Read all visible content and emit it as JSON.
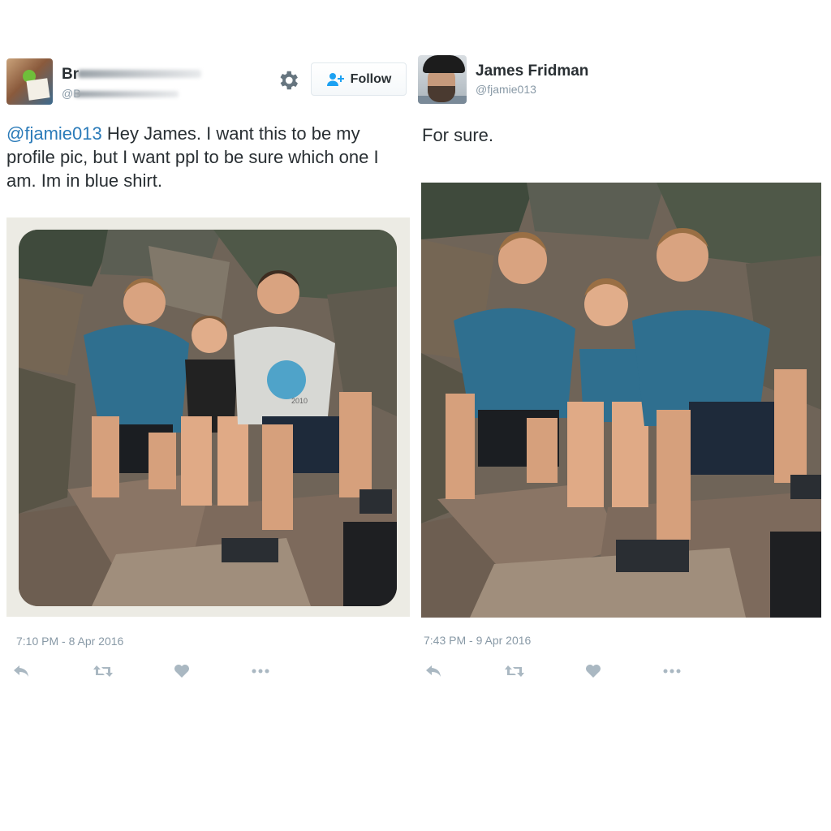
{
  "original_tweet": {
    "author_name_visible": "Br",
    "author_handle_visible": "@B",
    "follow_label": "Follow",
    "mention": "@fjamie013",
    "body": " Hey James. I want this to be my profile pic, but I want ppl to be sure which one I am. Im in blue shirt.",
    "timestamp": "7:10 PM - 8 Apr 2016",
    "photo_shirt_text": "2010",
    "actions": [
      "reply-icon",
      "retweet-icon",
      "like-icon",
      "more-icon"
    ]
  },
  "reply_tweet": {
    "author_name": "James Fridman",
    "author_handle": "@fjamie013",
    "body": "For sure.",
    "timestamp": "7:43 PM - 9 Apr 2016",
    "actions": [
      "reply-icon",
      "retweet-icon",
      "like-icon",
      "more-icon"
    ]
  },
  "colors": {
    "link": "#2b7bb9",
    "muted": "#8899a6",
    "icon": "#aab8c2",
    "text": "#292f33"
  }
}
